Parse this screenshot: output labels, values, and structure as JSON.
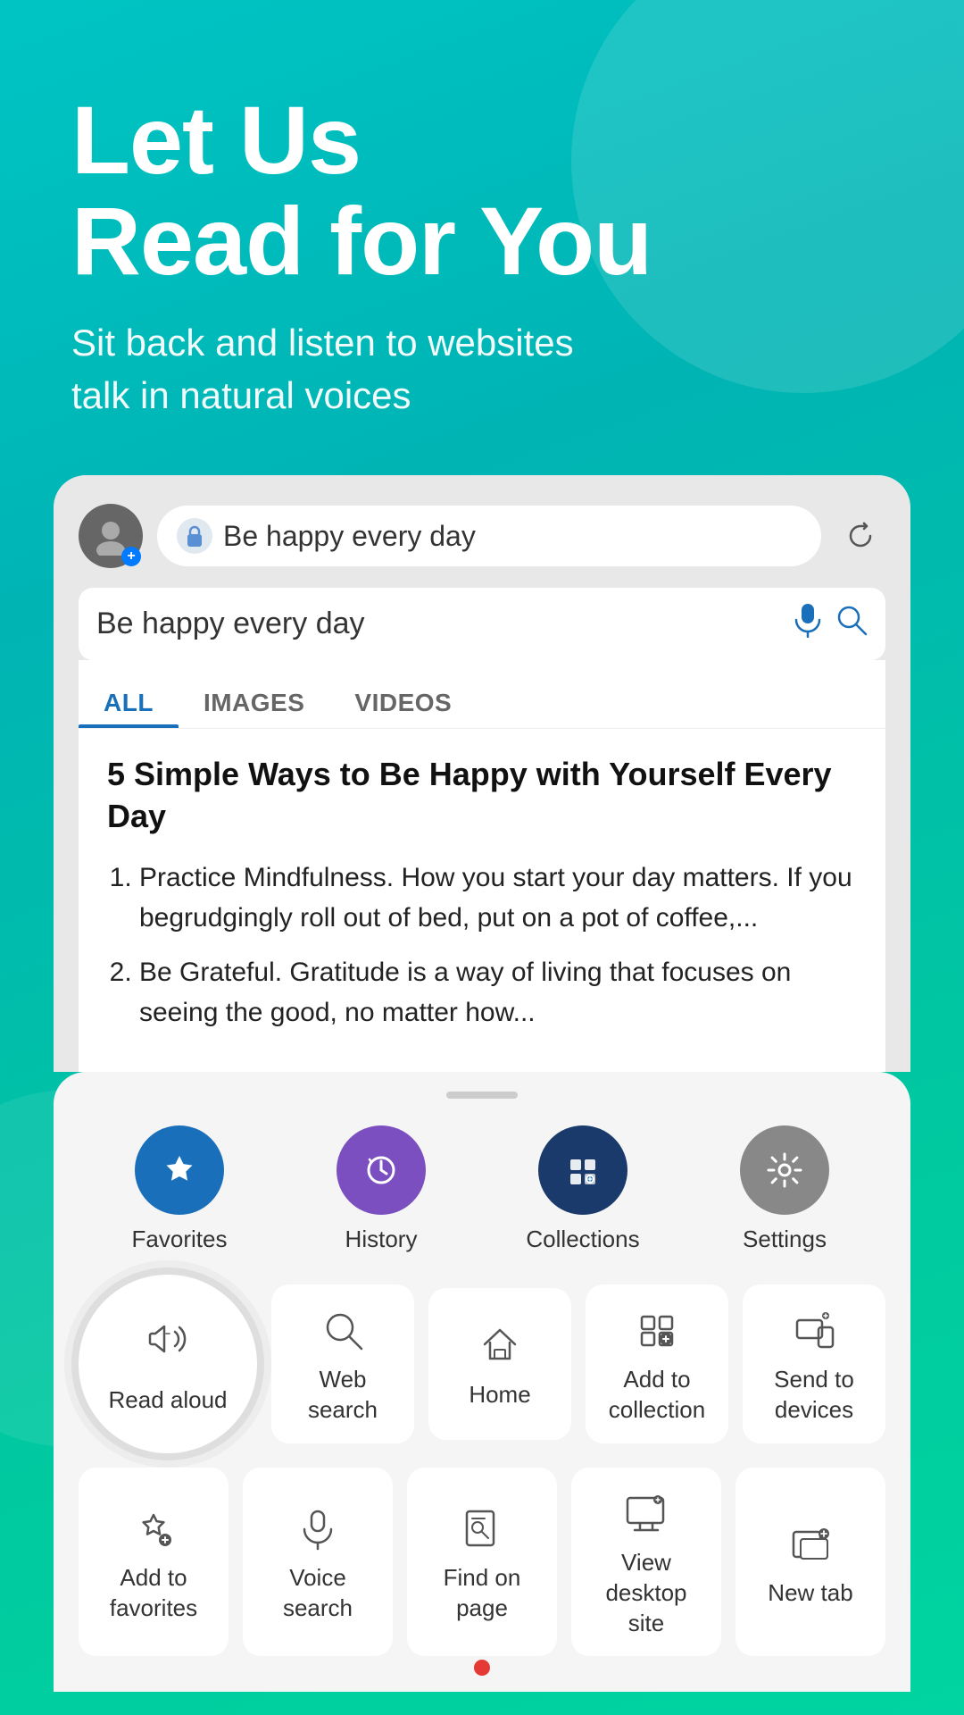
{
  "hero": {
    "title": "Let Us\nRead for You",
    "subtitle": "Sit back and listen to websites\ntalk in natural voices"
  },
  "browser": {
    "url_text": "Be happy every day",
    "search_text": "Be happy every day",
    "search_placeholder": "Be happy every day",
    "tabs": [
      {
        "label": "ALL",
        "active": true
      },
      {
        "label": "IMAGES",
        "active": false
      },
      {
        "label": "VIDEOS",
        "active": false
      }
    ]
  },
  "content": {
    "title": "5 Simple Ways to Be Happy with Yourself Every Day",
    "items": [
      "Practice Mindfulness. How you start your day matters. If you begrudgingly roll out of bed, put on a pot of coffee,...",
      "Be Grateful. Gratitude is a way of living that focuses on seeing the good, no matter how..."
    ]
  },
  "bottom_sheet": {
    "handle_label": "drag-handle",
    "top_menu": [
      {
        "label": "Favorites",
        "icon": "star",
        "icon_style": "blue"
      },
      {
        "label": "History",
        "icon": "history",
        "icon_style": "purple"
      },
      {
        "label": "Collections",
        "icon": "collections",
        "icon_style": "dark-blue"
      },
      {
        "label": "Settings",
        "icon": "settings",
        "icon_style": "gray"
      }
    ],
    "row1": [
      {
        "label": "Read aloud",
        "icon": "read-aloud",
        "highlighted": true
      },
      {
        "label": "Web search",
        "icon": "search"
      },
      {
        "label": "Home",
        "icon": "home"
      },
      {
        "label": "Add to\ncollection",
        "icon": "add-collection"
      },
      {
        "label": "Send to\ndevices",
        "icon": "send-devices"
      }
    ],
    "row2": [
      {
        "label": "Add to\nfavorites",
        "icon": "add-favorites"
      },
      {
        "label": "Voice\nsearch",
        "icon": "microphone"
      },
      {
        "label": "Find on\npage",
        "icon": "find-page"
      },
      {
        "label": "View\ndesktop\nsite",
        "icon": "desktop-site"
      },
      {
        "label": "New tab",
        "icon": "new-tab"
      }
    ]
  }
}
